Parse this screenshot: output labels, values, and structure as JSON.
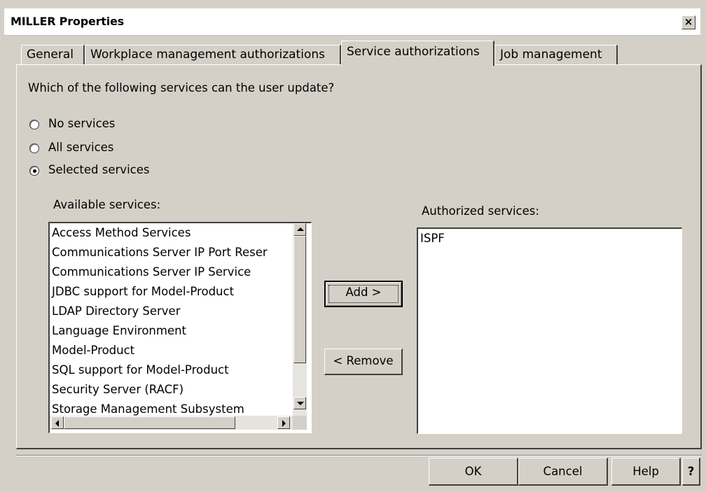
{
  "window": {
    "title": "MILLER Properties",
    "close_glyph": "×"
  },
  "tabs": [
    {
      "label": "General",
      "active": false
    },
    {
      "label": "Workplace management authorizations",
      "active": false
    },
    {
      "label": "Service authorizations",
      "active": true
    },
    {
      "label": "Job management",
      "active": false
    }
  ],
  "panel": {
    "question": "Which of the following services can the user update?",
    "radios": [
      {
        "label": "No services",
        "checked": false
      },
      {
        "label": "All services",
        "checked": false
      },
      {
        "label": "Selected services",
        "checked": true
      }
    ],
    "available": {
      "label": "Available services:",
      "items": [
        "Access Method Services",
        "Communications Server IP Port Reser",
        "Communications Server IP Service",
        "JDBC support for Model-Product",
        "LDAP Directory Server",
        "Language Environment",
        "Model-Product",
        "SQL support for Model-Product",
        "Security Server (RACF)",
        "Storage Management Subsystem"
      ]
    },
    "authorized": {
      "label": "Authorized services:",
      "items": [
        "ISPF"
      ]
    },
    "add_label": "Add >",
    "remove_label": "< Remove"
  },
  "footer": {
    "ok_label": "OK",
    "cancel_label": "Cancel",
    "help_label": "Help",
    "context_help_label": "?"
  },
  "colors": {
    "face": "#d4d0c8",
    "shadow": "#404040",
    "highlight": "#ffffff",
    "list_bg": "#ffffff"
  },
  "icons": [
    "close-icon",
    "scroll-up-arrow-icon",
    "scroll-down-arrow-icon",
    "scroll-left-arrow-icon",
    "scroll-right-arrow-icon"
  ]
}
